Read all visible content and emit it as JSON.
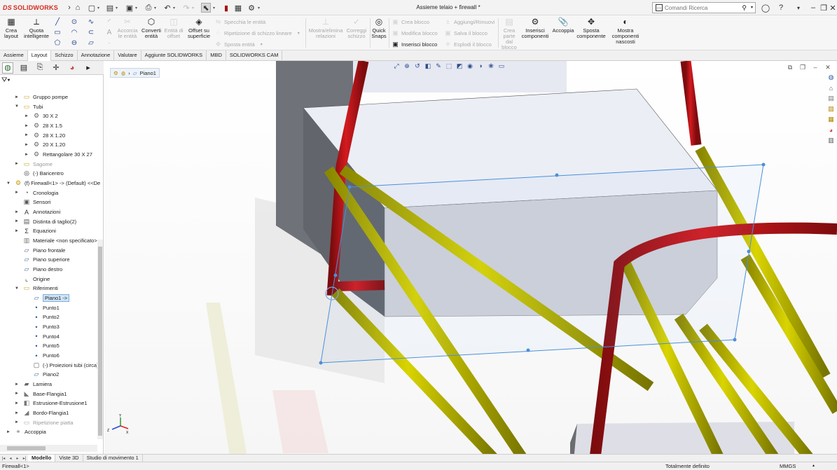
{
  "titlebar": {
    "logo_ds": "DS",
    "logo_text": "SOLIDWORKS",
    "doc_title": "Assieme telaio + firewall *",
    "search_placeholder": "Comandi Ricerca"
  },
  "command_manager": {
    "big_buttons": [
      {
        "label": "Crea layout",
        "icon": "layout-icon",
        "enabled": true
      },
      {
        "label": "Quota intelligente",
        "icon": "smart-dimension-icon",
        "enabled": true
      },
      {
        "label": "Accorcia le entità",
        "icon": "trim-icon",
        "enabled": false
      },
      {
        "label": "Converti entità",
        "icon": "convert-icon",
        "enabled": true
      },
      {
        "label": "Entità di offset",
        "icon": "offset-icon",
        "enabled": false
      },
      {
        "label": "Offset su superficie",
        "icon": "offset-surface-icon",
        "enabled": true
      },
      {
        "label": "Mostra/elimina relazioni",
        "icon": "relations-icon",
        "enabled": false
      },
      {
        "label": "Correggi schizzo",
        "icon": "repair-sketch-icon",
        "enabled": false
      },
      {
        "label": "Quick Snaps",
        "icon": "quick-snaps-icon",
        "enabled": true
      },
      {
        "label": "Crea parte dal blocco",
        "icon": "part-from-block-icon",
        "enabled": false
      },
      {
        "label": "Inserisci componenti",
        "icon": "insert-components-icon",
        "enabled": true
      },
      {
        "label": "Accoppia",
        "icon": "mate-icon",
        "enabled": true
      },
      {
        "label": "Sposta componente",
        "icon": "move-component-icon",
        "enabled": true
      },
      {
        "label": "Mostra componenti nascosti",
        "icon": "show-hidden-icon",
        "enabled": true
      }
    ],
    "small_rows": [
      {
        "label": "Specchia le entità",
        "enabled": false
      },
      {
        "label": "Ripetizione di schizzo lineare",
        "enabled": false
      },
      {
        "label": "Sposta entità",
        "enabled": false
      },
      {
        "label": "Crea blocco",
        "enabled": false
      },
      {
        "label": "Modifica blocco",
        "enabled": false
      },
      {
        "label": "Inserisci blocco",
        "enabled": true
      },
      {
        "label": "Aggiungi/Rimuovi",
        "enabled": false
      },
      {
        "label": "Salva il blocco",
        "enabled": false
      },
      {
        "label": "Esplodi il blocco",
        "enabled": false
      }
    ]
  },
  "tabs": [
    "Assieme",
    "Layout",
    "Schizzo",
    "Annotazione",
    "Valutare",
    "Aggiunte SOLIDWORKS",
    "MBD",
    "SOLIDWORKS CAM"
  ],
  "active_tab": "Layout",
  "tree": [
    {
      "label": "Gruppo pompe",
      "level": 1,
      "toggle": "►",
      "icon": "folder-icon"
    },
    {
      "label": "Tubi",
      "level": 1,
      "toggle": "▼",
      "icon": "folder-icon"
    },
    {
      "label": "30 X 2",
      "level": 2,
      "toggle": "►",
      "icon": "weldment-profile-icon"
    },
    {
      "label": "28 X 1.5",
      "level": 2,
      "toggle": "►",
      "icon": "weldment-profile-icon"
    },
    {
      "label": "28 X 1.20",
      "level": 2,
      "toggle": "►",
      "icon": "weldment-profile-icon"
    },
    {
      "label": "20 X 1.20",
      "level": 2,
      "toggle": "►",
      "icon": "weldment-profile-icon"
    },
    {
      "label": "Rettangolare 30 X 27",
      "level": 2,
      "toggle": "►",
      "icon": "weldment-profile-icon"
    },
    {
      "label": "Sagome",
      "level": 1,
      "toggle": "►",
      "icon": "folder-icon",
      "dim": true
    },
    {
      "label": "(-) Baricentro",
      "level": 1,
      "toggle": "",
      "icon": "center-of-mass-icon"
    },
    {
      "label": "(f) Firewall<1> -> (Default) <<De",
      "level": 0,
      "toggle": "▼",
      "icon": "part-icon"
    },
    {
      "label": "Cronologia",
      "level": 1,
      "toggle": "►",
      "icon": "history-icon"
    },
    {
      "label": "Sensori",
      "level": 1,
      "toggle": "",
      "icon": "sensor-icon"
    },
    {
      "label": "Annotazioni",
      "level": 1,
      "toggle": "►",
      "icon": "annotation-icon"
    },
    {
      "label": "Distinta di taglio(2)",
      "level": 1,
      "toggle": "►",
      "icon": "cut-list-icon"
    },
    {
      "label": "Equazioni",
      "level": 1,
      "toggle": "►",
      "icon": "equation-icon"
    },
    {
      "label": "Materiale <non specificato>",
      "level": 1,
      "toggle": "",
      "icon": "material-icon"
    },
    {
      "label": "Piano frontale",
      "level": 1,
      "toggle": "",
      "icon": "plane-icon"
    },
    {
      "label": "Piano superiore",
      "level": 1,
      "toggle": "",
      "icon": "plane-icon"
    },
    {
      "label": "Piano destro",
      "level": 1,
      "toggle": "",
      "icon": "plane-icon"
    },
    {
      "label": "Origine",
      "level": 1,
      "toggle": "",
      "icon": "origin-icon"
    },
    {
      "label": "Riferimenti",
      "level": 1,
      "toggle": "▼",
      "icon": "folder-icon"
    },
    {
      "label": "Piano1 ->",
      "level": 2,
      "toggle": "",
      "icon": "plane-icon",
      "selected": true
    },
    {
      "label": "Punto1",
      "level": 2,
      "toggle": "",
      "icon": "point-icon"
    },
    {
      "label": "Punto2",
      "level": 2,
      "toggle": "",
      "icon": "point-icon"
    },
    {
      "label": "Punto3",
      "level": 2,
      "toggle": "",
      "icon": "point-icon"
    },
    {
      "label": "Punto4",
      "level": 2,
      "toggle": "",
      "icon": "point-icon"
    },
    {
      "label": "Punto5",
      "level": 2,
      "toggle": "",
      "icon": "point-icon"
    },
    {
      "label": "Punto6",
      "level": 2,
      "toggle": "",
      "icon": "point-icon"
    },
    {
      "label": "(-) Proiezioni tubi (circa)",
      "level": 2,
      "toggle": "",
      "icon": "sketch-icon"
    },
    {
      "label": "Piano2",
      "level": 2,
      "toggle": "",
      "icon": "plane-icon"
    },
    {
      "label": "Lamiera",
      "level": 1,
      "toggle": "►",
      "icon": "sheet-metal-icon"
    },
    {
      "label": "Base-Flangia1",
      "level": 1,
      "toggle": "►",
      "icon": "base-flange-icon"
    },
    {
      "label": "Estrusione-Estrusione1",
      "level": 1,
      "toggle": "►",
      "icon": "extrude-icon"
    },
    {
      "label": "Bordo-Flangia1",
      "level": 1,
      "toggle": "►",
      "icon": "edge-flange-icon"
    },
    {
      "label": "Ripetizione piatta",
      "level": 1,
      "toggle": "►",
      "icon": "flat-pattern-icon",
      "dim": true
    },
    {
      "label": "Accoppia",
      "level": 0,
      "toggle": "►",
      "icon": "mates-icon"
    }
  ],
  "breadcrumb": {
    "item": "Piano1"
  },
  "triad": {
    "x": "X",
    "y": "Y",
    "z": "Z"
  },
  "bottom_tabs": [
    "Modello",
    "Viste 3D",
    "Studio di movimento 1"
  ],
  "active_bottom_tab": "Modello",
  "status": {
    "left": "Firewall<1>",
    "center": "Totalmente definito",
    "units": "MMGS"
  },
  "colors": {
    "red_tube": "#c8161b",
    "yellow_tube": "#c9c400",
    "plane": "#4a90d9",
    "firewall_gray": "#e9eaf0",
    "accent": "#d52b1e"
  }
}
